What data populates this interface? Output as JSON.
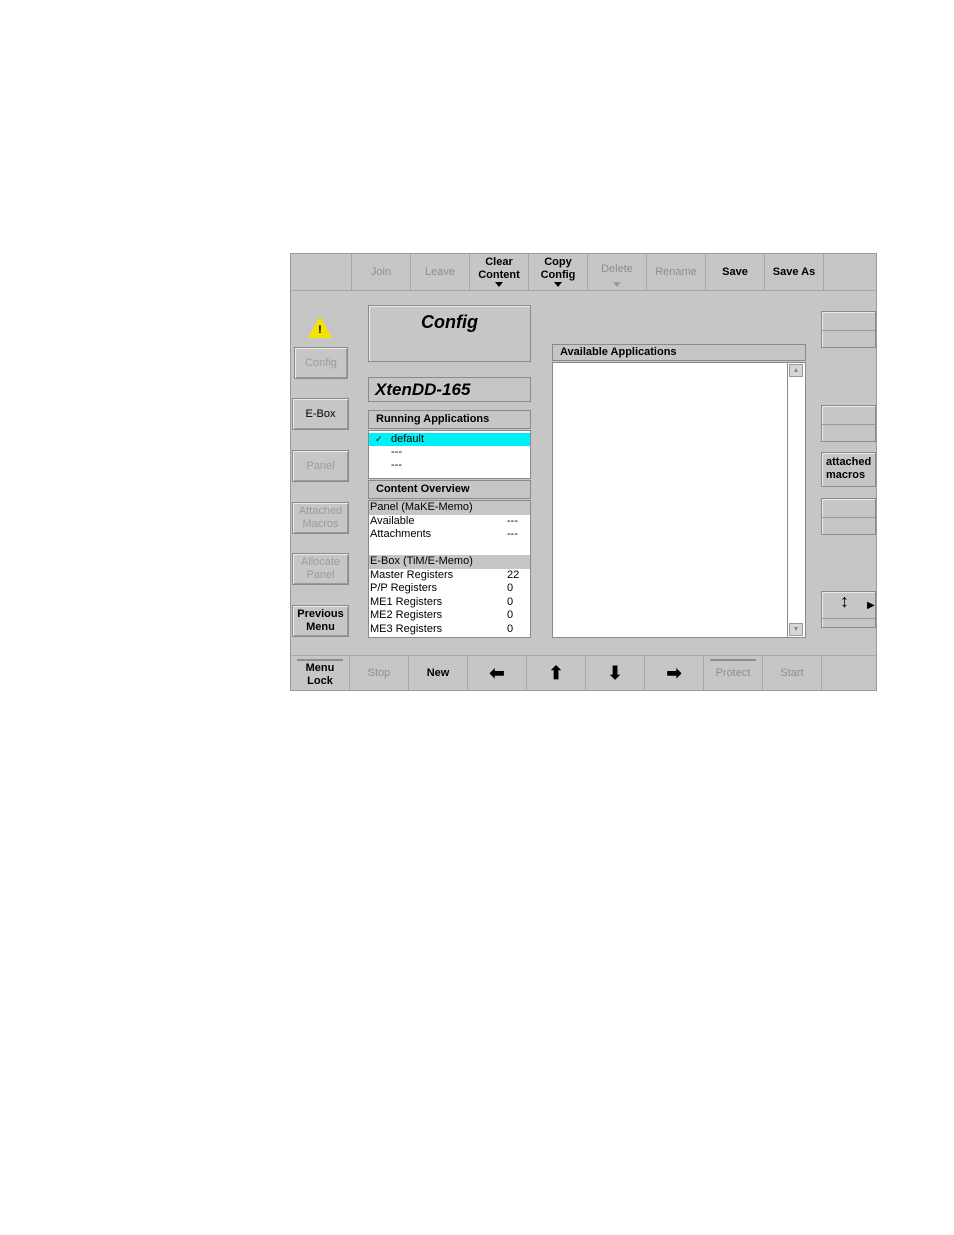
{
  "top_toolbar": [
    {
      "label": "",
      "enabled": true,
      "dropdown": false
    },
    {
      "label": "Join",
      "enabled": false,
      "dropdown": false
    },
    {
      "label": "Leave",
      "enabled": false,
      "dropdown": false
    },
    {
      "label": "Clear\nContent",
      "enabled": true,
      "dropdown": true
    },
    {
      "label": "Copy\nConfig",
      "enabled": true,
      "dropdown": true
    },
    {
      "label": "Delete",
      "enabled": false,
      "dropdown": true
    },
    {
      "label": "Rename",
      "enabled": false,
      "dropdown": false
    },
    {
      "label": "Save",
      "enabled": true,
      "dropdown": false
    },
    {
      "label": "Save As",
      "enabled": true,
      "dropdown": false
    }
  ],
  "sidebar": [
    {
      "label": "Config",
      "enabled": false
    },
    {
      "label": "E-Box",
      "enabled": true
    },
    {
      "label": "Panel",
      "enabled": false
    },
    {
      "label": "Attached\nMacros",
      "enabled": false
    },
    {
      "label": "Allocate\nPanel",
      "enabled": false
    },
    {
      "label": "Previous\nMenu",
      "enabled": true
    }
  ],
  "warning_icon": "warning-triangle-icon",
  "title": "Config",
  "device_name": "XtenDD-165",
  "running_apps": {
    "header": "Running Applications",
    "items": [
      "default",
      "---",
      "---"
    ],
    "selected": 0
  },
  "content_overview": {
    "header": "Content Overview",
    "panel_section": "Panel (MaKE-Memo)",
    "panel_rows": [
      {
        "label": "Available",
        "value": "---"
      },
      {
        "label": "Attachments",
        "value": "---"
      }
    ],
    "ebox_section": "E-Box (TiM/E-Memo)",
    "ebox_rows": [
      {
        "label": "Master Registers",
        "value": "22"
      },
      {
        "label": "P/P Registers",
        "value": "0"
      },
      {
        "label": "ME1 Registers",
        "value": "0"
      },
      {
        "label": "ME2 Registers",
        "value": "0"
      },
      {
        "label": "ME3 Registers",
        "value": "0"
      }
    ]
  },
  "available_apps": {
    "header": "Available Applications"
  },
  "right_panel": {
    "attached_macros": "attached\nmacros",
    "scroll_icon": "up-down-arrow-icon"
  },
  "bottom_toolbar": [
    {
      "label": "Menu\nLock",
      "enabled": true
    },
    {
      "label": "Stop",
      "enabled": false
    },
    {
      "label": "New",
      "enabled": true
    },
    {
      "label": "⬅",
      "enabled": true,
      "icon": "arrow-left-icon"
    },
    {
      "label": "⬆",
      "enabled": true,
      "icon": "arrow-up-icon"
    },
    {
      "label": "⬇",
      "enabled": true,
      "icon": "arrow-down-icon"
    },
    {
      "label": "➡",
      "enabled": true,
      "icon": "arrow-right-icon"
    },
    {
      "label": "Protect",
      "enabled": false
    },
    {
      "label": "Start",
      "enabled": false
    }
  ]
}
